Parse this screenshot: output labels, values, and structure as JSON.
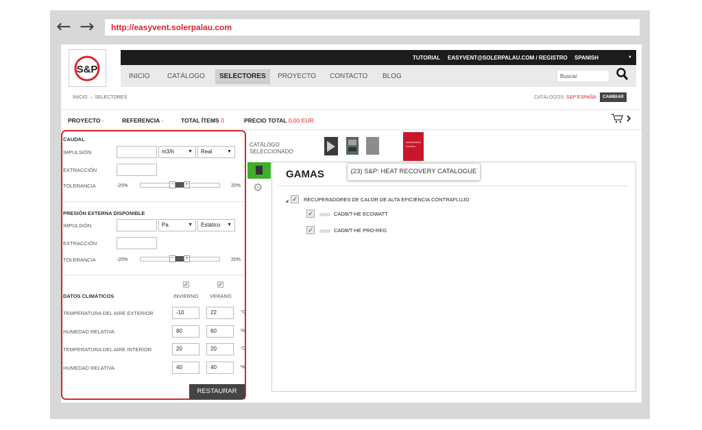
{
  "browser": {
    "back_icon": "arrow-left-icon",
    "forward_icon": "arrow-right-icon",
    "url": "http://easyvent.solerpalau.com"
  },
  "brand": {
    "logo_text": "S&P",
    "accent": "#d9232e"
  },
  "topbar": {
    "tutorial": "TUTORIAL",
    "account": "EASYVENT@SOLERPALAU.COM / REGISTRO",
    "language": "SPANISH"
  },
  "nav": {
    "items": [
      "INICIO",
      "CATÁLOGO",
      "SELECTORES",
      "PROYECTO",
      "CONTACTO",
      "BLOG"
    ],
    "active": "SELECTORES",
    "search_placeholder": "Buscar"
  },
  "breadcrumb": {
    "home": "INICIO",
    "arrow": "→",
    "current": "SELECTORES"
  },
  "catalogs": {
    "label": "CATÁLOGOS:",
    "value": "S&P ESPAÑA",
    "button": "CAMBIAR"
  },
  "summary": {
    "proyecto_label": "PROYECTO",
    "proyecto_value": "-",
    "referencia_label": "REFERENCIA",
    "referencia_value": "-",
    "items_label": "TOTAL ÍTEMS",
    "items_value": "0",
    "precio_label": "PRECIO TOTAL",
    "precio_value": "0,00 EUR"
  },
  "caudal": {
    "title": "CAUDAL",
    "impulsion": "IMPULSIÓN",
    "extraccion": "EXTRACCIÓN",
    "tolerancia": "TOLERANCIA",
    "unit": "m3/h",
    "mode": "Real",
    "min": "-20%",
    "max": "20%"
  },
  "presion": {
    "title": "PRESIÓN EXTERNA DISPONIBLE",
    "impulsion": "IMPULSIÓN",
    "extraccion": "EXTRACCIÓN",
    "tolerancia": "TOLERANCIA",
    "unit": "Pa",
    "mode": "Estático",
    "min": "-20%",
    "max": "20%"
  },
  "climaticos": {
    "title": "DATOS CLIMÁTICOS",
    "invierno": "INVIERNO",
    "verano": "VERANO",
    "rows": [
      {
        "label": "TEMPERATURA DEL AIRE EXTERIOR",
        "invierno": "-10",
        "verano": "22",
        "unit": "°C"
      },
      {
        "label": "HUMEDAD RELATIVA",
        "invierno": "80",
        "verano": "60",
        "unit": "%"
      },
      {
        "label": "TEMPERATURA DEL AIRE INTERIOR",
        "invierno": "20",
        "verano": "20",
        "unit": "°C"
      },
      {
        "label": "HUMEDAD RELATIVA",
        "invierno": "40",
        "verano": "40",
        "unit": "%"
      }
    ],
    "restaurar": "RESTAURAR"
  },
  "catalogo": {
    "label_line1": "CATÁLOGO",
    "label_line2": "SELECCIONADO"
  },
  "gamas": {
    "title": "GAMAS",
    "tooltip": "(23) S&P: HEAT RECOVERY CATALOGUE",
    "group": "RECUPERADORES DE CALOR DE ALTA EFICIENCIA CONTRAFLUJO",
    "items": [
      "CADB/T-HE ECOWATT",
      "CADB/T-HE PRO-REG"
    ]
  }
}
